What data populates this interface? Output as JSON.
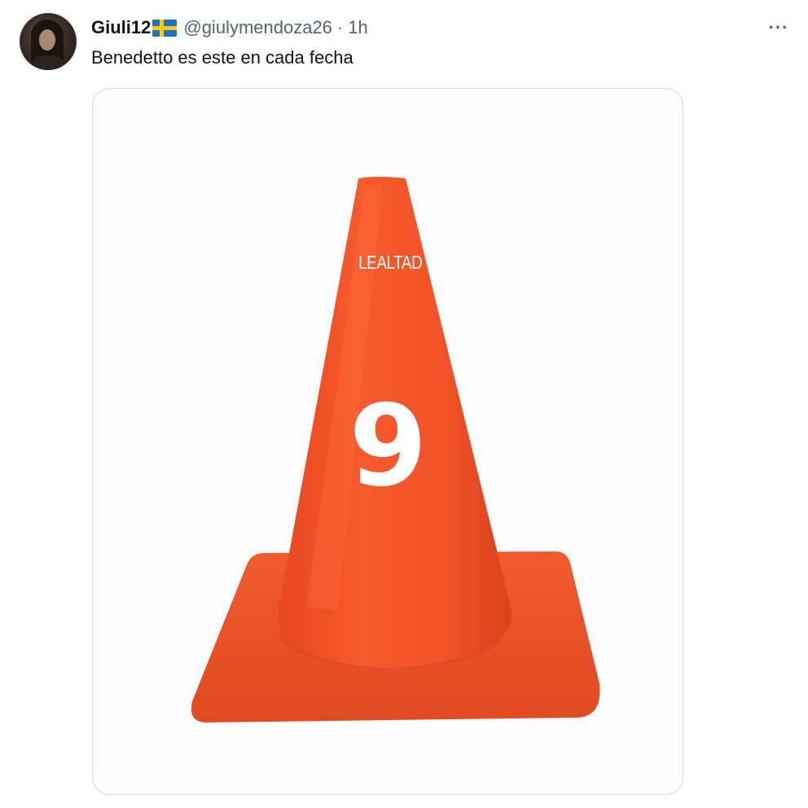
{
  "tweet": {
    "display_name": "Giuli12",
    "handle": "@giulymendoza26",
    "separator": "·",
    "time": "1h",
    "more_label": "···",
    "text": "Benedetto es este en cada fecha",
    "flag_icon": "sweden-flag-icon",
    "avatar_icon": "user-avatar"
  },
  "media": {
    "cone_label": "LEALTAD",
    "cone_number": "9",
    "cone_color": "#f2562b"
  }
}
